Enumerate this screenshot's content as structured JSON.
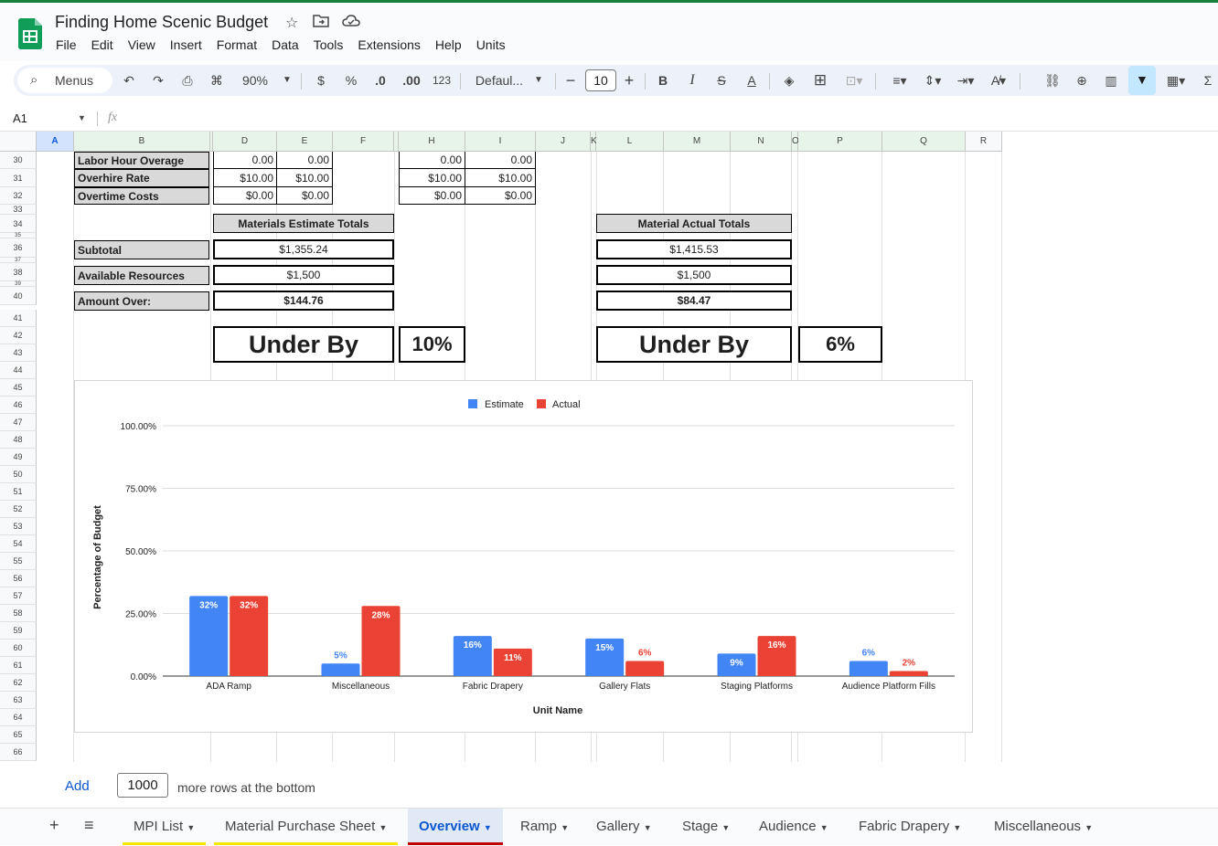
{
  "app": {
    "title": "Finding Home Scenic Budget",
    "menus": [
      "File",
      "Edit",
      "View",
      "Insert",
      "Format",
      "Data",
      "Tools",
      "Extensions",
      "Help",
      "Units"
    ]
  },
  "toolbar": {
    "menus_label": "Menus",
    "zoom": "90%",
    "currency": "$",
    "percent": "%",
    "dec_decrease": ".0",
    "dec_increase": ".00",
    "num_format": "123",
    "font": "Defaul...",
    "minus": "−",
    "font_size": "10",
    "plus": "+",
    "bold": "B",
    "italic": "I"
  },
  "formula": {
    "cell_ref": "A1",
    "fx": "fx"
  },
  "columns": [
    "A",
    "B",
    "D",
    "E",
    "F",
    "H",
    "I",
    "J",
    "K",
    "L",
    "M",
    "N",
    "O",
    "P",
    "Q",
    "R"
  ],
  "rows": [
    "30",
    "31",
    "32",
    "33",
    "34",
    "35",
    "36",
    "37",
    "38",
    "39",
    "40",
    "41",
    "42",
    "43",
    "44",
    "45",
    "46",
    "47",
    "48",
    "49",
    "50",
    "51",
    "52",
    "53",
    "54",
    "55",
    "56",
    "57",
    "58",
    "59",
    "60",
    "61",
    "62",
    "63",
    "64",
    "65",
    "66"
  ],
  "sheet": {
    "labor_hour_overage": "Labor Hour Overage",
    "overhire_rate": "Overhire Rate",
    "overtime_costs": "Overtime Costs",
    "d30": "0.00",
    "e30": "0.00",
    "h30": "0.00",
    "i30": "0.00",
    "d31": "$10.00",
    "e31": "$10.00",
    "h31": "$10.00",
    "i31": "$10.00",
    "d32": "$0.00",
    "e32": "$0.00",
    "h32": "$0.00",
    "i32": "$0.00",
    "mat_est_totals": "Materials Estimate Totals",
    "mat_act_totals": "Material Actual Totals",
    "subtotal_label": "Subtotal",
    "available_label": "Available Resources",
    "amount_over_label": "Amount Over:",
    "est_subtotal": "$1,355.24",
    "act_subtotal": "$1,415.53",
    "est_available": "$1,500",
    "act_available": "$1,500",
    "est_over": "$144.76",
    "act_over": "$84.47",
    "est_status": "Under By",
    "est_pct": "10%",
    "act_status": "Under By",
    "act_pct": "6%"
  },
  "chart_data": {
    "type": "bar",
    "categories": [
      "ADA Ramp",
      "Miscellaneous",
      "Fabric Drapery",
      "Gallery Flats",
      "Staging Platforms",
      "Audience Platform Fills"
    ],
    "series": [
      {
        "name": "Estimate",
        "values": [
          32,
          5,
          16,
          15,
          9,
          6
        ],
        "color": "#4285f4"
      },
      {
        "name": "Actual",
        "values": [
          32,
          28,
          11,
          6,
          16,
          2
        ],
        "color": "#ea4335"
      }
    ],
    "data_labels": [
      [
        "32%",
        "5%",
        "16%",
        "15%",
        "9%",
        "6%"
      ],
      [
        "32%",
        "28%",
        "11%",
        "6%",
        "16%",
        "2%"
      ]
    ],
    "xlabel": "Unit Name",
    "ylabel": "Percentage of Budget",
    "yticks": [
      "0.00%",
      "25.00%",
      "50.00%",
      "75.00%",
      "100.00%"
    ],
    "ylim": [
      0,
      100
    ],
    "legend": "top"
  },
  "add_rows": {
    "button": "Add",
    "count": "1000",
    "suffix": "more rows at the bottom"
  },
  "tabs": [
    {
      "label": "MPI List",
      "color": "#f4e800"
    },
    {
      "label": "Material Purchase Sheet",
      "color": "#f4e800"
    },
    {
      "label": "Overview",
      "color": "#c00000",
      "active": true
    },
    {
      "label": "Ramp"
    },
    {
      "label": "Gallery"
    },
    {
      "label": "Stage"
    },
    {
      "label": "Audience"
    },
    {
      "label": "Fabric Drapery"
    },
    {
      "label": "Miscellaneous"
    }
  ]
}
